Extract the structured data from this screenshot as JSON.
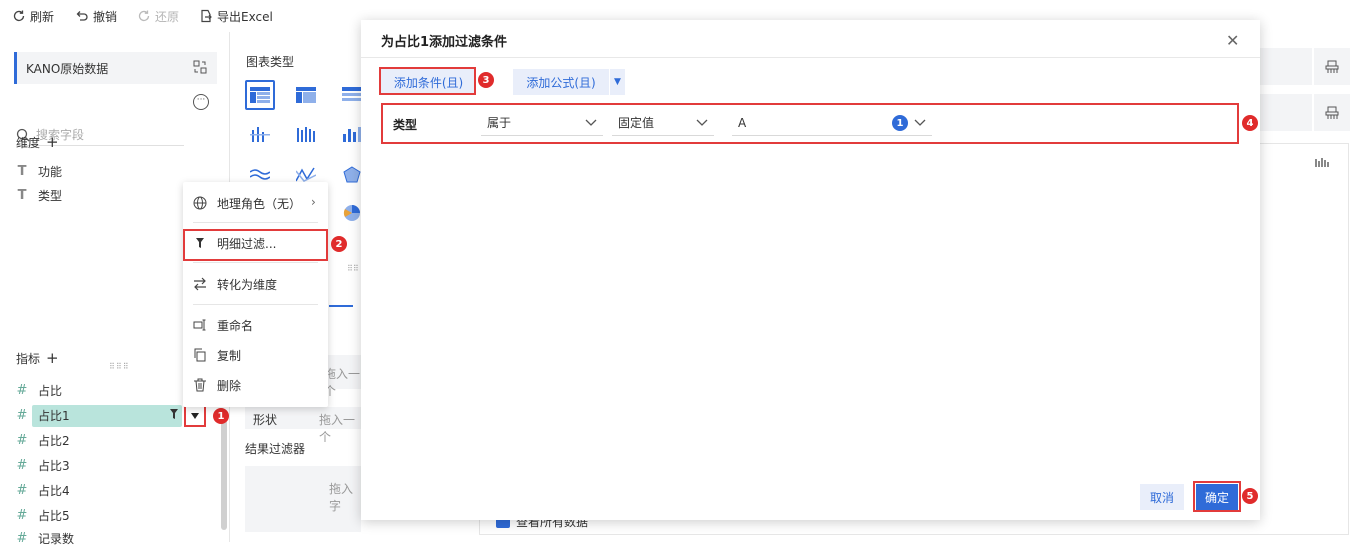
{
  "toolbar": {
    "refresh": "刷新",
    "undo": "撤销",
    "redo": "还原",
    "export": "导出Excel"
  },
  "left": {
    "datasource": "KANO原始数据",
    "search_placeholder": "搜索字段",
    "dimension_title": "维度",
    "dimensions": [
      "功能",
      "类型"
    ],
    "measure_title": "指标",
    "measures": [
      "占比",
      "占比1",
      "占比2",
      "占比3",
      "占比4",
      "占比5",
      "记录数"
    ]
  },
  "middle": {
    "chart_type_title": "图表类型",
    "shape_label": "形状",
    "drop_hint_1": "拖入一个",
    "drop_hint_2": "拖入一个",
    "result_filter": "结果过滤器",
    "drop_hint_3": "拖入字"
  },
  "context_menu": {
    "geo_role": "地理角色（无）",
    "detail_filter": "明细过滤...",
    "to_dimension": "转化为维度",
    "rename": "重命名",
    "copy": "复制",
    "delete": "删除"
  },
  "badges": [
    "1",
    "2",
    "3",
    "4",
    "5"
  ],
  "dialog": {
    "title": "为占比1添加过滤条件",
    "add_condition": "添加条件(且)",
    "add_formula": "添加公式(且)",
    "condition": {
      "field": "类型",
      "operator": "属于",
      "value_type": "固定值",
      "value": "A",
      "count": "1"
    },
    "cancel": "取消",
    "confirm": "确定"
  },
  "bottom": {
    "show_all": "查看所有数据"
  },
  "colors": {
    "accent": "#2f6bd8",
    "highlight_red": "#e23b3b",
    "selected_field": "#b9e4dc"
  }
}
